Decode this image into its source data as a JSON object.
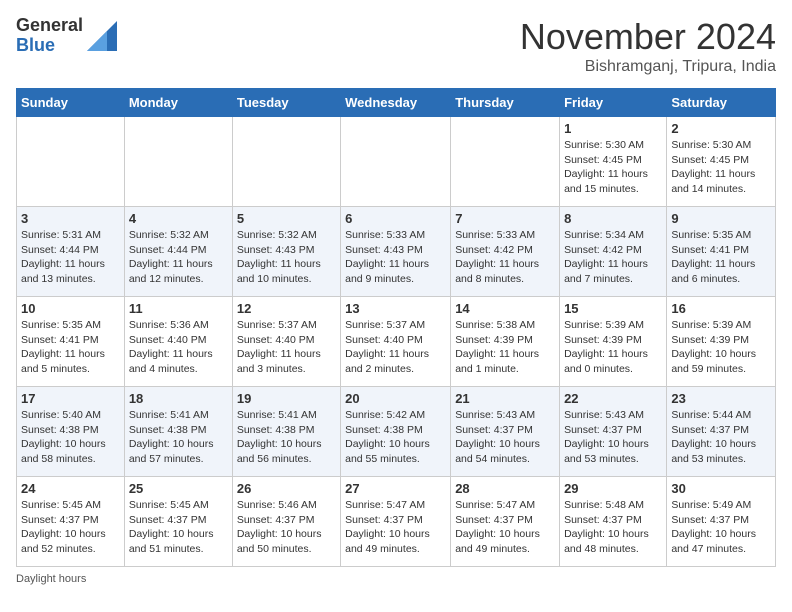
{
  "logo": {
    "general": "General",
    "blue": "Blue"
  },
  "title": "November 2024",
  "location": "Bishramganj, Tripura, India",
  "days_of_week": [
    "Sunday",
    "Monday",
    "Tuesday",
    "Wednesday",
    "Thursday",
    "Friday",
    "Saturday"
  ],
  "footer_text": "Daylight hours",
  "weeks": [
    [
      {
        "day": "",
        "info": ""
      },
      {
        "day": "",
        "info": ""
      },
      {
        "day": "",
        "info": ""
      },
      {
        "day": "",
        "info": ""
      },
      {
        "day": "",
        "info": ""
      },
      {
        "day": "1",
        "info": "Sunrise: 5:30 AM\nSunset: 4:45 PM\nDaylight: 11 hours and 15 minutes."
      },
      {
        "day": "2",
        "info": "Sunrise: 5:30 AM\nSunset: 4:45 PM\nDaylight: 11 hours and 14 minutes."
      }
    ],
    [
      {
        "day": "3",
        "info": "Sunrise: 5:31 AM\nSunset: 4:44 PM\nDaylight: 11 hours and 13 minutes."
      },
      {
        "day": "4",
        "info": "Sunrise: 5:32 AM\nSunset: 4:44 PM\nDaylight: 11 hours and 12 minutes."
      },
      {
        "day": "5",
        "info": "Sunrise: 5:32 AM\nSunset: 4:43 PM\nDaylight: 11 hours and 10 minutes."
      },
      {
        "day": "6",
        "info": "Sunrise: 5:33 AM\nSunset: 4:43 PM\nDaylight: 11 hours and 9 minutes."
      },
      {
        "day": "7",
        "info": "Sunrise: 5:33 AM\nSunset: 4:42 PM\nDaylight: 11 hours and 8 minutes."
      },
      {
        "day": "8",
        "info": "Sunrise: 5:34 AM\nSunset: 4:42 PM\nDaylight: 11 hours and 7 minutes."
      },
      {
        "day": "9",
        "info": "Sunrise: 5:35 AM\nSunset: 4:41 PM\nDaylight: 11 hours and 6 minutes."
      }
    ],
    [
      {
        "day": "10",
        "info": "Sunrise: 5:35 AM\nSunset: 4:41 PM\nDaylight: 11 hours and 5 minutes."
      },
      {
        "day": "11",
        "info": "Sunrise: 5:36 AM\nSunset: 4:40 PM\nDaylight: 11 hours and 4 minutes."
      },
      {
        "day": "12",
        "info": "Sunrise: 5:37 AM\nSunset: 4:40 PM\nDaylight: 11 hours and 3 minutes."
      },
      {
        "day": "13",
        "info": "Sunrise: 5:37 AM\nSunset: 4:40 PM\nDaylight: 11 hours and 2 minutes."
      },
      {
        "day": "14",
        "info": "Sunrise: 5:38 AM\nSunset: 4:39 PM\nDaylight: 11 hours and 1 minute."
      },
      {
        "day": "15",
        "info": "Sunrise: 5:39 AM\nSunset: 4:39 PM\nDaylight: 11 hours and 0 minutes."
      },
      {
        "day": "16",
        "info": "Sunrise: 5:39 AM\nSunset: 4:39 PM\nDaylight: 10 hours and 59 minutes."
      }
    ],
    [
      {
        "day": "17",
        "info": "Sunrise: 5:40 AM\nSunset: 4:38 PM\nDaylight: 10 hours and 58 minutes."
      },
      {
        "day": "18",
        "info": "Sunrise: 5:41 AM\nSunset: 4:38 PM\nDaylight: 10 hours and 57 minutes."
      },
      {
        "day": "19",
        "info": "Sunrise: 5:41 AM\nSunset: 4:38 PM\nDaylight: 10 hours and 56 minutes."
      },
      {
        "day": "20",
        "info": "Sunrise: 5:42 AM\nSunset: 4:38 PM\nDaylight: 10 hours and 55 minutes."
      },
      {
        "day": "21",
        "info": "Sunrise: 5:43 AM\nSunset: 4:37 PM\nDaylight: 10 hours and 54 minutes."
      },
      {
        "day": "22",
        "info": "Sunrise: 5:43 AM\nSunset: 4:37 PM\nDaylight: 10 hours and 53 minutes."
      },
      {
        "day": "23",
        "info": "Sunrise: 5:44 AM\nSunset: 4:37 PM\nDaylight: 10 hours and 53 minutes."
      }
    ],
    [
      {
        "day": "24",
        "info": "Sunrise: 5:45 AM\nSunset: 4:37 PM\nDaylight: 10 hours and 52 minutes."
      },
      {
        "day": "25",
        "info": "Sunrise: 5:45 AM\nSunset: 4:37 PM\nDaylight: 10 hours and 51 minutes."
      },
      {
        "day": "26",
        "info": "Sunrise: 5:46 AM\nSunset: 4:37 PM\nDaylight: 10 hours and 50 minutes."
      },
      {
        "day": "27",
        "info": "Sunrise: 5:47 AM\nSunset: 4:37 PM\nDaylight: 10 hours and 49 minutes."
      },
      {
        "day": "28",
        "info": "Sunrise: 5:47 AM\nSunset: 4:37 PM\nDaylight: 10 hours and 49 minutes."
      },
      {
        "day": "29",
        "info": "Sunrise: 5:48 AM\nSunset: 4:37 PM\nDaylight: 10 hours and 48 minutes."
      },
      {
        "day": "30",
        "info": "Sunrise: 5:49 AM\nSunset: 4:37 PM\nDaylight: 10 hours and 47 minutes."
      }
    ]
  ]
}
